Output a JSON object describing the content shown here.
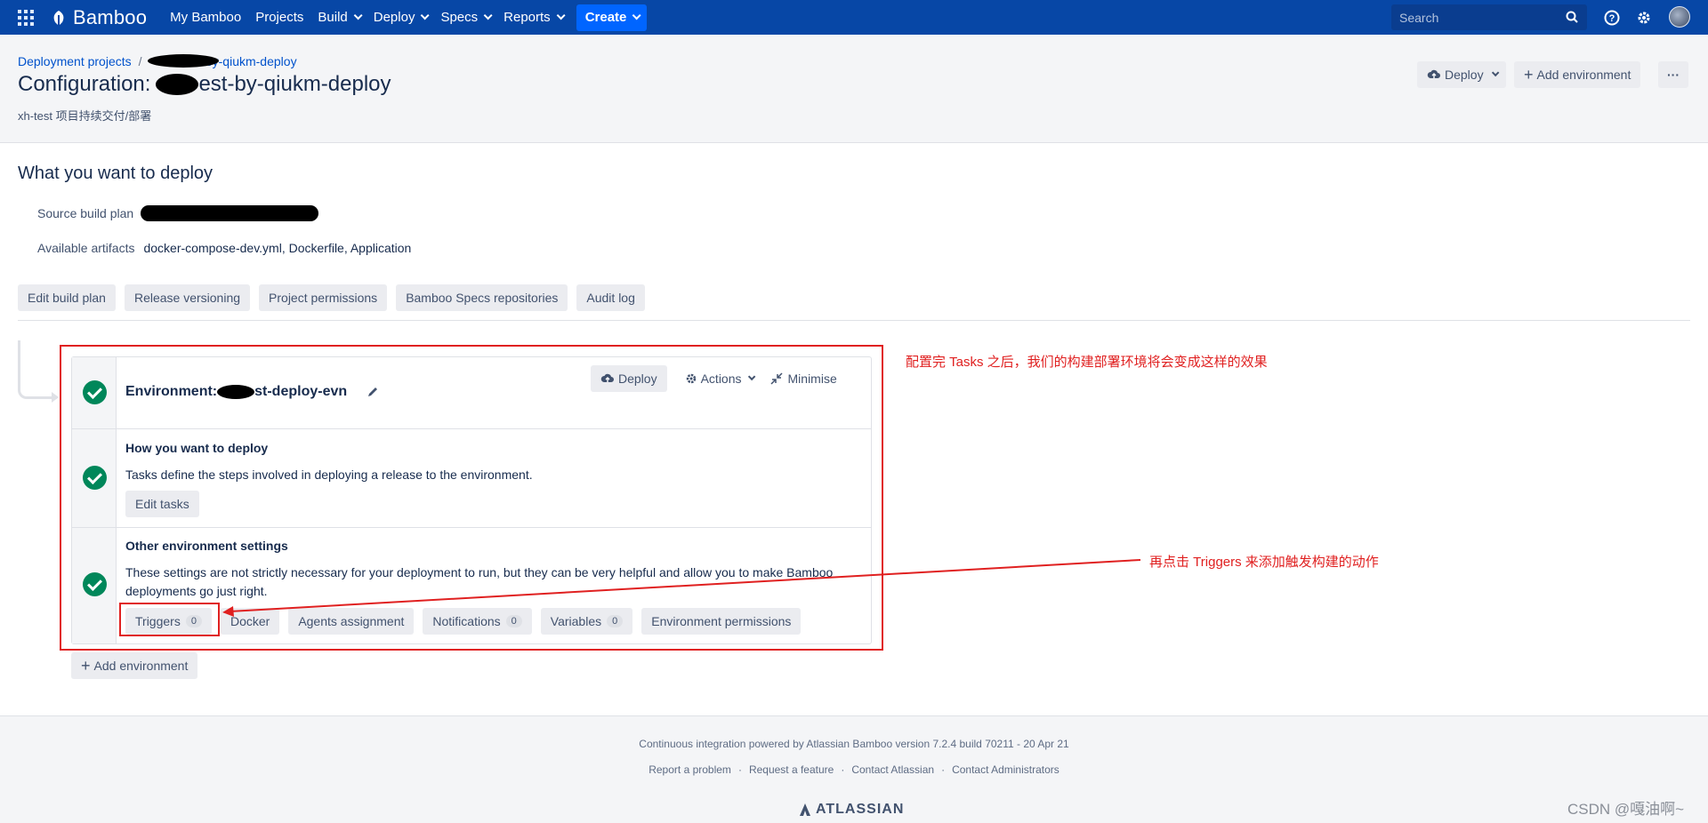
{
  "topnav": {
    "app_name": "Bamboo",
    "items": [
      "My Bamboo",
      "Projects",
      "Build",
      "Deploy",
      "Specs",
      "Reports"
    ],
    "create_label": "Create",
    "search_placeholder": "Search"
  },
  "header": {
    "breadcrumb_root": "Deployment projects",
    "breadcrumb_project_visible": "est-by-qiukm-deploy",
    "title_prefix": "Configuration:",
    "title_visible": "est-by-qiukm-deploy",
    "subtitle": "xh-test 项目持续交付/部署",
    "deploy_label": "Deploy",
    "add_environment_label": "Add environment",
    "more_label": "···"
  },
  "what_to_deploy": {
    "title": "What you want to deploy",
    "source_build_plan_label": "Source build plan",
    "available_artifacts_label": "Available artifacts",
    "available_artifacts_value": "docker-compose-dev.yml, Dockerfile, Application",
    "buttons": [
      "Edit build plan",
      "Release versioning",
      "Project permissions",
      "Bamboo Specs repositories",
      "Audit log"
    ]
  },
  "environment": {
    "name_prefix": "Environment:",
    "name_visible": "st-deploy-evn",
    "deploy_label": "Deploy",
    "actions_label": "Actions",
    "minimise_label": "Minimise",
    "how_title": "How you want to deploy",
    "how_text": "Tasks define the steps involved in deploying a release to the environment.",
    "edit_tasks_label": "Edit tasks",
    "other_title": "Other environment settings",
    "other_text": "These settings are not strictly necessary for your deployment to run, but they can be very helpful and allow you to make Bamboo deployments go just right.",
    "settings": [
      {
        "label": "Triggers",
        "count": "0"
      },
      {
        "label": "Docker",
        "count": null
      },
      {
        "label": "Agents assignment",
        "count": null
      },
      {
        "label": "Notifications",
        "count": "0"
      },
      {
        "label": "Variables",
        "count": "0"
      },
      {
        "label": "Environment permissions",
        "count": null
      }
    ]
  },
  "add_environment_label": "Add environment",
  "annotations": {
    "note1": "配置完 Tasks 之后，我们的构建部署环境将会变成这样的效果",
    "note2": "再点击 Triggers 来添加触发构建的动作"
  },
  "footer": {
    "powered_by": "Continuous integration powered by Atlassian Bamboo version 7.2.4 build 70211 - 20 Apr 21",
    "links": [
      "Report a problem",
      "Request a feature",
      "Contact Atlassian",
      "Contact Administrators"
    ],
    "brand": "ATLASSIAN"
  },
  "watermark": "CSDN @嘎油啊~",
  "colors": {
    "nav": "#0747a6",
    "create": "#0065ff",
    "success": "#00875a",
    "annotation": "#e02020"
  }
}
